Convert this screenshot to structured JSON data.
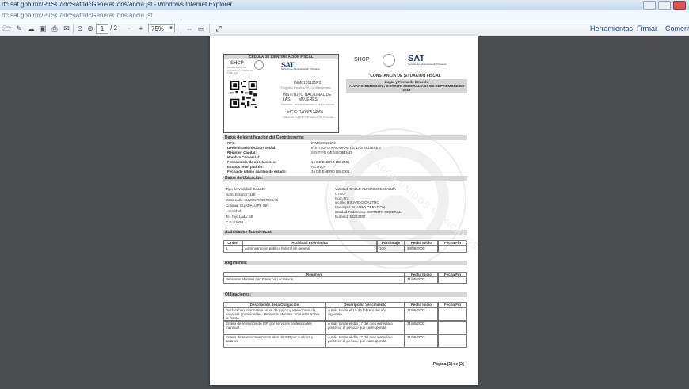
{
  "window": {
    "title": "rfc.sat.gob.mx/PTSC/IdcSiat/IdcGeneraConstancia.jsf - Windows Internet Explorer",
    "address": "rfc.sat.gob.mx/PTSC/IdcSiat/IdcGeneraConstancia.jsf"
  },
  "toolbar": {
    "page_current": "1",
    "page_total": "/ 2",
    "zoom": "75%",
    "links": [
      "Herramientas",
      "Firmar",
      "Comentar"
    ]
  },
  "document": {
    "card": {
      "header": "CÉDULA DE IDENTIFICACIÓN FISCAL",
      "shcp": "SHCP",
      "shcp_sub": "SECRETARÍA DE HACIENDA Y CRÉDITO PÚBLICO",
      "sat": "SAT",
      "sat_sub": "Servicio de Administración Tributaria",
      "rfc": "INM0101121P2",
      "rfc_caption": "Registro Federal de Contribuyentes",
      "name_lines": [
        "INSTITUTO NACIONAL DE LAS",
        "MUJERES"
      ],
      "name_caption": "Nombre, denominación o razón social",
      "idcif": "idCIF: 14080524905",
      "idcif_caption": "VALIDA TU INFORMACIÓN FISCAL"
    },
    "constancia": {
      "title": "CONSTANCIA DE SITUACIÓN FISCAL",
      "place_label": "Lugar y Fecha de Emisión",
      "place_value": "ALVARO OBREGON , DISTRITO FEDERAL A 17 DE SEPTIEMBRE DE 2012"
    },
    "contribuyente": {
      "section": "Datos de Identificación del Contribuyente:",
      "fields": [
        {
          "label": "RFC:",
          "value": "INM0101121P2"
        },
        {
          "label": "Denominación/Razón Social:",
          "value": "INSTITUTO NACIONAL DE LAS MUJERES"
        },
        {
          "label": "Régimen Capital:",
          "value": "SIN TIPO DE SOCIEDAD"
        },
        {
          "label": "Nombre Comercial:",
          "value": ""
        },
        {
          "label": "Fecha inicio de operaciones:",
          "value": "15 DE ENERO DE 2001"
        },
        {
          "label": "Estatus en el padrón:",
          "value": "ACTIVO"
        },
        {
          "label": "Fecha de último cambio de estado:",
          "value": "15 DE ENERO DE 2001"
        }
      ]
    },
    "ubicacion": {
      "section": "Datos de Ubicación:",
      "left": [
        "Tipo de Vialidad: CALLE",
        "Núm. Exterior: 115",
        "Entre calle: JUVENTINO ROSAS",
        "Colonia: GUADALUPE INN",
        "Localidad:",
        "Tel. Fijo Lada: 55",
        "C.P.:01020"
      ],
      "right": [
        "Vialidad: CALLE ALFONSO ESPARZA",
        "OTEO",
        "Núm. Int:",
        "y calle: RICARDO CASTRO",
        "Municipio: ALVARO OBREGON",
        "Entidad Federativa: DISTRITO FEDERAL",
        "Número: 53224397"
      ]
    },
    "actividades": {
      "section": "Actividades Económicas:",
      "headers": [
        "Orden",
        "Actividad Económica",
        "Porcentaje",
        "Fecha Inicio",
        "Fecha Fin"
      ],
      "rows": [
        [
          "1",
          "Administración pública federal en general",
          "100",
          "30/05/2008",
          ""
        ]
      ]
    },
    "regimenes": {
      "section": "Regímenes:",
      "headers": [
        "Régimen",
        "Fecha Inicio",
        "Fecha Fin"
      ],
      "rows": [
        [
          "Personas Morales con Fines no Lucrativos",
          "31/05/2002",
          ""
        ]
      ]
    },
    "obligaciones": {
      "section": "Obligaciones:",
      "headers": [
        "Descripción de la Obligación",
        "Descripción Vencimiento",
        "Fecha Inicio",
        "Fecha Fin"
      ],
      "rows": [
        [
          "Declaración informativa anual de pagos y retenciones de servicios profesionales. Personas Morales. Impuesto Sobre la Renta",
          "A más tardar el 15 de febrero del año siguiente.",
          "31/05/2002",
          ""
        ],
        [
          "Entero de retención de ISR por servicios profesionales mensual",
          "A más tardar el día 17 del mes inmediato posterior al periodo que corresponda.",
          "31/05/2002",
          ""
        ],
        [
          "Entero de retenciones mensuales de ISR por sueldos y salarios",
          "A más tardar el día 17 del mes inmediato posterior al periodo que corresponda.",
          "31/05/2002",
          ""
        ]
      ]
    },
    "watermark": "ESTADOS UNIDOS MEXICANOS",
    "footer": "Página [1] de [2]"
  }
}
